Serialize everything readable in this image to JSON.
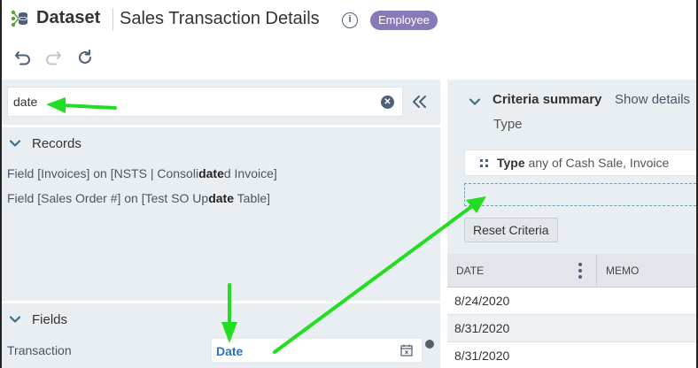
{
  "header": {
    "app_name": "Dataset",
    "page_title": "Sales Transaction Details",
    "info_icon": "info-icon",
    "role_badge": "Employee",
    "badge_color": "#8a79b8"
  },
  "toolbar": {
    "icons": [
      "undo-icon",
      "redo-icon",
      "refresh-icon"
    ]
  },
  "left_panel": {
    "search": {
      "value": "date",
      "placeholder": ""
    },
    "records": {
      "title": "Records",
      "items": [
        {
          "before": "Field [Invoices] on [NSTS | Consoli",
          "match": "date",
          "after": "d Invoice]"
        },
        {
          "before": "Field [Sales Order #] on [Test SO Up",
          "match": "date",
          "after": " Table]"
        }
      ]
    },
    "fields": {
      "title": "Fields",
      "row_label": "Transaction",
      "chip_label": "Date"
    }
  },
  "right_panel": {
    "criteria": {
      "title": "Criteria summary",
      "show_details": "Show details",
      "type_label": "Type",
      "chip_field": "Type",
      "chip_text": " any of Cash Sale, Invoice",
      "reset_label": "Reset Criteria"
    },
    "grid": {
      "columns": [
        "DATE",
        "MEMO"
      ],
      "rows": [
        "8/24/2020",
        "8/31/2020",
        "8/31/2020"
      ]
    }
  },
  "colors": {
    "accent_link": "#2a6fc9",
    "panel_bg": "#e9eef2",
    "annotation_arrow": "#22dd22"
  }
}
